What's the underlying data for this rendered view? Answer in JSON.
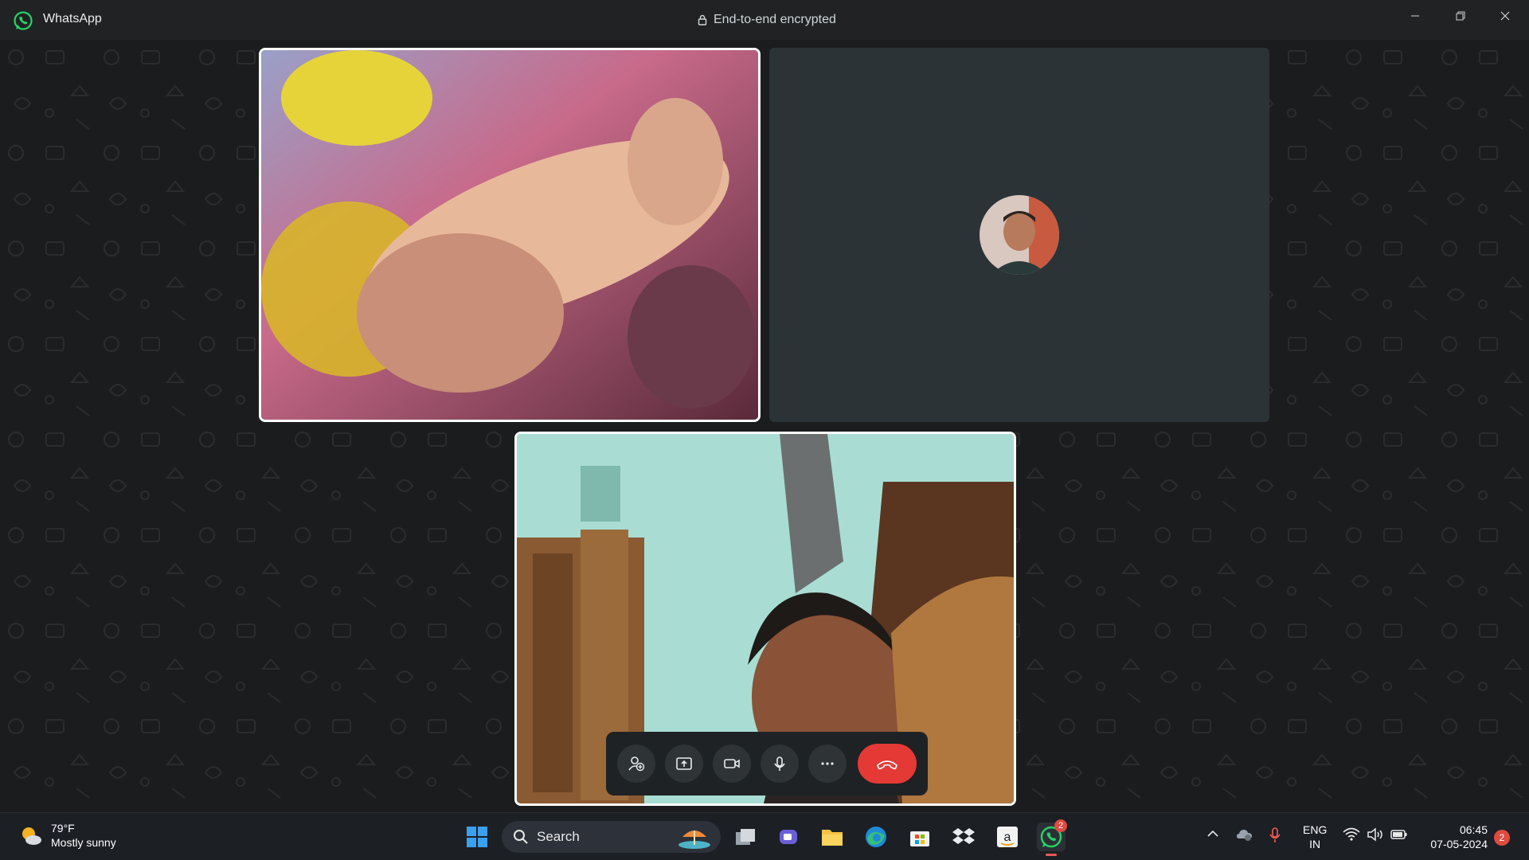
{
  "app": {
    "title": "WhatsApp",
    "encryption_label": "End-to-end encrypted"
  },
  "window_controls": [
    "minimize-icon",
    "restore-icon",
    "close-icon"
  ],
  "call": {
    "participants": [
      {
        "kind": "video",
        "highlighted": true
      },
      {
        "kind": "avatar",
        "highlighted": false
      },
      {
        "kind": "self-video",
        "highlighted": true
      }
    ],
    "controls": [
      "add-participant-icon",
      "share-screen-icon",
      "camera-icon",
      "microphone-icon",
      "more-options-icon",
      "end-call-icon"
    ],
    "end_call_color": "#e53935"
  },
  "taskbar": {
    "weather": {
      "temperature": "79°F",
      "condition": "Mostly sunny"
    },
    "search_placeholder": "Search",
    "apps": [
      "windows-start-icon",
      "task-view-icon",
      "teams-icon",
      "file-explorer-icon",
      "edge-icon",
      "store-icon",
      "dropbox-icon",
      "amazon-icon",
      "whatsapp-icon"
    ],
    "whatsapp_badge": "2",
    "language": {
      "line1": "ENG",
      "line2": "IN"
    },
    "clock": {
      "time": "06:45",
      "date": "07-05-2024"
    },
    "notifications": "2"
  },
  "colors": {
    "accent": "#25d366",
    "titlebar": "#202223",
    "tile_bg": "#2b3336"
  }
}
